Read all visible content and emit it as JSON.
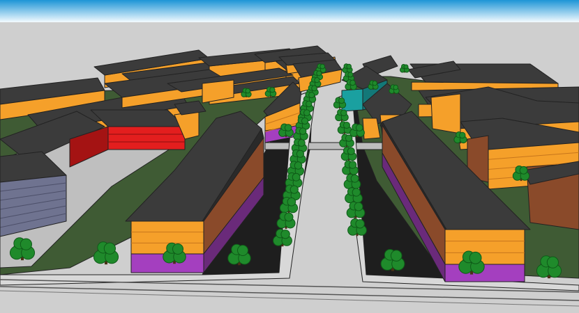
{
  "scene": {
    "kind": "3d-massing-model",
    "palette": {
      "sky_top": "#1d95d6",
      "sky_bottom": "#f4fbff",
      "ground": "#cfcfcf",
      "sidewalk": "#d8d8d8",
      "grass": "#3f5b34",
      "road": "#1e1e1e",
      "roof": "#3b3b3b",
      "roof_dark": "#2a2a2a",
      "residential": "#f5a02a",
      "residential_dark": "#c7761c",
      "side_wall": "#8a4a2a",
      "retail": "#a43fbf",
      "commercial": "#e31e1e",
      "commercial_dark": "#a41313",
      "parking_structure": "#6f7390",
      "accent_building": "#1aa0a0",
      "tree": "#1f8a2b",
      "tree_dark": "#0f5a18",
      "trunk": "#4a3216"
    },
    "legend_uses": [
      "residential",
      "retail",
      "commercial",
      "parking_structure",
      "accent_building"
    ]
  }
}
